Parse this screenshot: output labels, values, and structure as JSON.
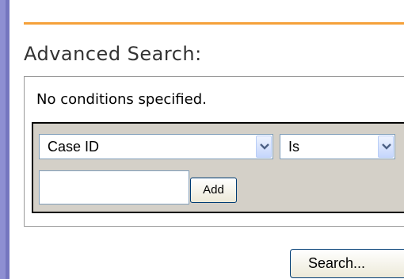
{
  "section_title": "Advanced Search:",
  "status_text": "No conditions specified.",
  "condition_builder": {
    "field_select": {
      "selected": "Case ID",
      "icon": "chevron-down-icon"
    },
    "operator_select": {
      "selected": "Is",
      "icon": "chevron-down-icon"
    },
    "value_input": {
      "value": ""
    },
    "add_label": "Add"
  },
  "search_label": "Search...",
  "colors": {
    "accent_rule": "#f5a13a",
    "left_bar": "#8e8fd2",
    "builder_bg": "#d4d0c8"
  }
}
